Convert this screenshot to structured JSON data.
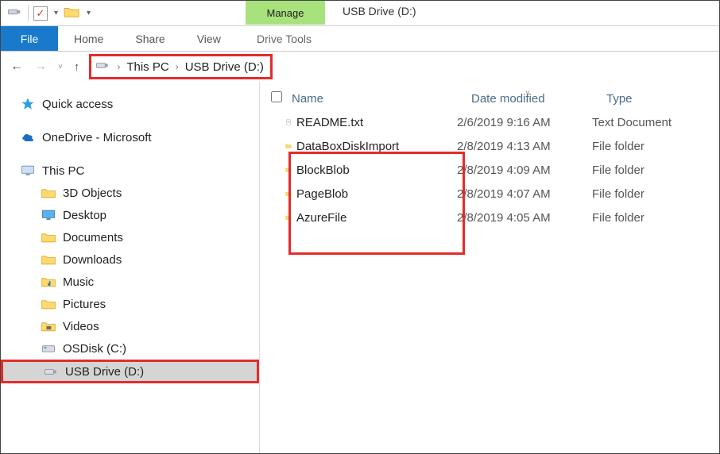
{
  "title_tab_context": "Manage",
  "window_title": "USB Drive (D:)",
  "ribbon": {
    "file": "File",
    "home": "Home",
    "share": "Share",
    "view": "View",
    "drive_tools": "Drive Tools"
  },
  "breadcrumb": {
    "root": "This PC",
    "leaf": "USB Drive (D:)"
  },
  "sidebar": {
    "quick_access": "Quick access",
    "onedrive": "OneDrive - Microsoft",
    "this_pc": "This PC",
    "items": [
      "3D Objects",
      "Desktop",
      "Documents",
      "Downloads",
      "Music",
      "Pictures",
      "Videos",
      "OSDisk (C:)",
      "USB Drive (D:)"
    ]
  },
  "columns": {
    "name": "Name",
    "date": "Date modified",
    "type": "Type"
  },
  "rows": [
    {
      "name": "README.txt",
      "date": "2/6/2019 9:16 AM",
      "type": "Text Document",
      "icon": "textfile"
    },
    {
      "name": "DataBoxDiskImport",
      "date": "2/8/2019 4:13 AM",
      "type": "File folder",
      "icon": "folder"
    },
    {
      "name": "BlockBlob",
      "date": "2/8/2019 4:09 AM",
      "type": "File folder",
      "icon": "folder"
    },
    {
      "name": "PageBlob",
      "date": "2/8/2019 4:07 AM",
      "type": "File folder",
      "icon": "folder"
    },
    {
      "name": "AzureFile",
      "date": "2/8/2019 4:05 AM",
      "type": "File folder",
      "icon": "folder"
    }
  ]
}
